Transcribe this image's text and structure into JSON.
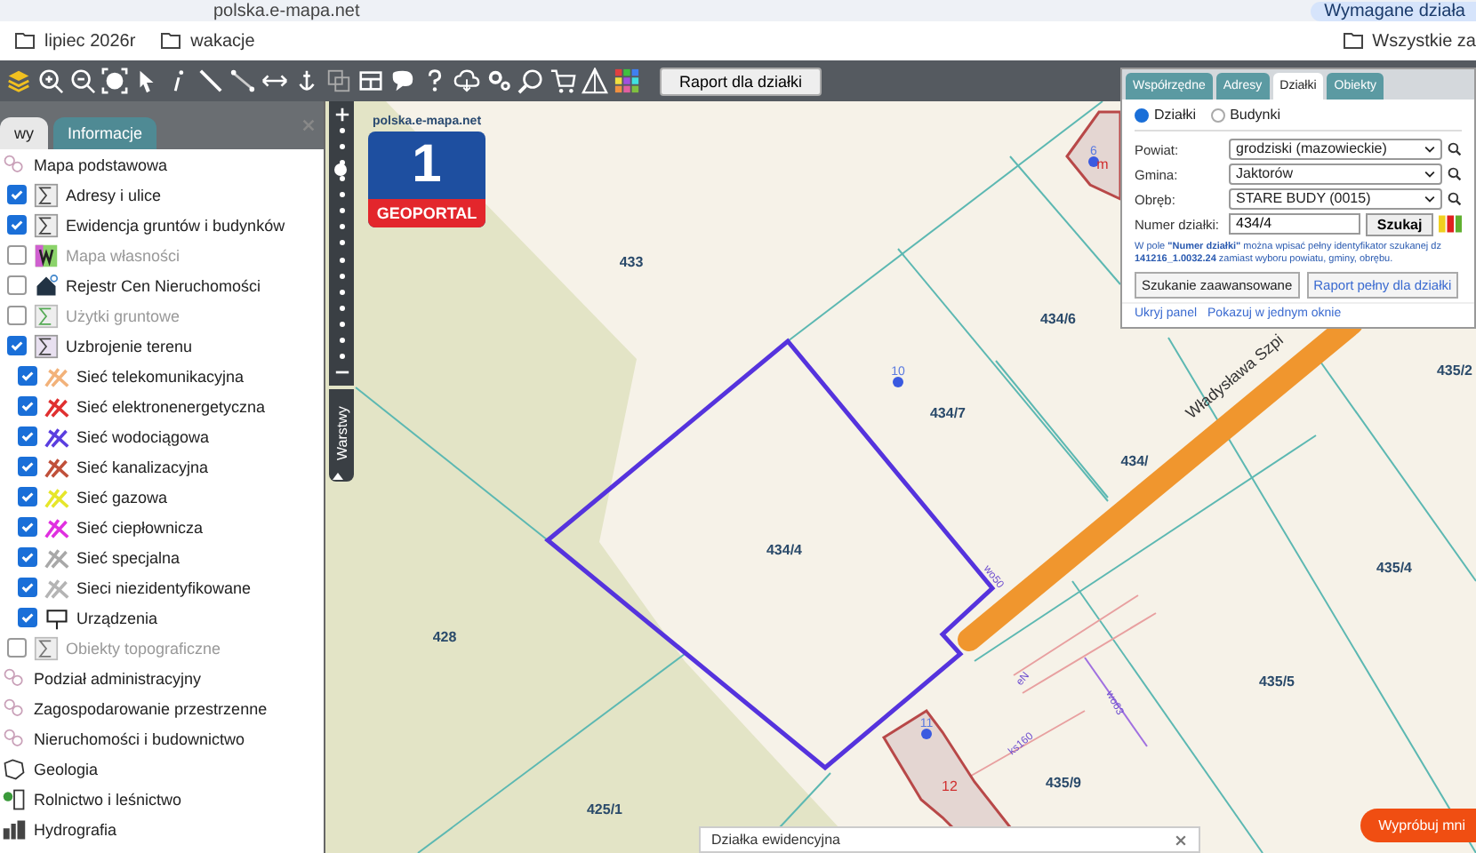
{
  "browser": {
    "address": "polska.e-mapa.net",
    "notice": "Wymagane działa",
    "bookmarks": [
      "lipiec 2026r",
      "wakacje"
    ],
    "all_bookmarks": "Wszystkie za"
  },
  "toolbar": {
    "report_button": "Raport dla działki"
  },
  "sidebar": {
    "tabs": [
      {
        "label": "wy",
        "selected": true
      },
      {
        "label": "Informacje",
        "selected": false
      }
    ],
    "layers": [
      {
        "kind": "category",
        "label": "Mapa podstawowa"
      },
      {
        "kind": "layer",
        "label": "Adresy i ulice",
        "checked": true,
        "disabled": false
      },
      {
        "kind": "layer",
        "label": "Ewidencja gruntów i budynków",
        "checked": true,
        "disabled": false
      },
      {
        "kind": "layer",
        "label": "Mapa własności",
        "checked": false,
        "disabled": true
      },
      {
        "kind": "layer",
        "label": "Rejestr Cen Nieruchomości",
        "checked": false,
        "disabled": false
      },
      {
        "kind": "layer",
        "label": "Użytki gruntowe",
        "checked": false,
        "disabled": true
      },
      {
        "kind": "layer",
        "label": "Uzbrojenie terenu",
        "checked": true,
        "disabled": false,
        "children": [
          {
            "kind": "network",
            "label": "Sieć telekomunikacyjna",
            "checked": true,
            "color": "#f2b27a"
          },
          {
            "kind": "network",
            "label": "Sieć elektronenergetyczna",
            "checked": true,
            "color": "#e03030"
          },
          {
            "kind": "network",
            "label": "Sieć wodociągowa",
            "checked": true,
            "color": "#5a3ee0"
          },
          {
            "kind": "network",
            "label": "Sieć kanalizacyjna",
            "checked": true,
            "color": "#c0503a"
          },
          {
            "kind": "network",
            "label": "Sieć gazowa",
            "checked": true,
            "color": "#e6e62a"
          },
          {
            "kind": "network",
            "label": "Sieć ciepłownicza",
            "checked": true,
            "color": "#e030e0"
          },
          {
            "kind": "network",
            "label": "Sieć specjalna",
            "checked": true,
            "color": "#a8a8a8"
          },
          {
            "kind": "network",
            "label": "Sieci niezidentyfikowane",
            "checked": true,
            "color": "#b4b4b4"
          },
          {
            "kind": "device",
            "label": "Urządzenia",
            "checked": true
          }
        ]
      },
      {
        "kind": "layer",
        "label": "Obiekty topograficzne",
        "checked": false,
        "disabled": true
      },
      {
        "kind": "category",
        "label": "Podział administracyjny"
      },
      {
        "kind": "category",
        "label": "Zagospodarowanie przestrzenne"
      },
      {
        "kind": "category",
        "label": "Nieruchomości i budownictwo"
      },
      {
        "kind": "category",
        "label": "Geologia"
      },
      {
        "kind": "category",
        "label": "Rolnictwo i leśnictwo"
      },
      {
        "kind": "category",
        "label": "Hydrografia"
      }
    ]
  },
  "map": {
    "zoom": {
      "level": 0.82
    },
    "layers_tab": "Warstwy",
    "logo": {
      "site": "polska.e-mapa.net",
      "number": "1",
      "name": "GEOPORTAL"
    },
    "parcel_labels": [
      "433",
      "434/6",
      "434/7",
      "434/4",
      "428",
      "425/1",
      "435/9",
      "435/5",
      "435/4",
      "435/2",
      "434/"
    ],
    "street": "Władysława Szpi",
    "pins": [
      "10",
      "11",
      "6"
    ],
    "building_labels": [
      "12",
      "m"
    ],
    "utility_labels": [
      "wo50",
      "wo63",
      "ks160",
      "eN"
    ],
    "popup": {
      "title": "Działka ewidencyjna"
    },
    "try_button": "Wypróbuj mni"
  },
  "search_panel": {
    "tabs": [
      {
        "label": "Współrzędne",
        "selected": false
      },
      {
        "label": "Adresy",
        "selected": false
      },
      {
        "label": "Działki",
        "selected": true
      },
      {
        "label": "Obiekty",
        "selected": false
      }
    ],
    "modes": [
      {
        "label": "Działki",
        "selected": true
      },
      {
        "label": "Budynki",
        "selected": false
      }
    ],
    "fields": [
      {
        "label": "Powiat:",
        "value": "grodziski (mazowieckie)"
      },
      {
        "label": "Gmina:",
        "value": "Jaktorów"
      },
      {
        "label": "Obręb:",
        "value": "STARE BUDY (0015)"
      }
    ],
    "number_field": {
      "label": "Numer działki:",
      "value": "434/4"
    },
    "search_button": "Szukaj",
    "hint": "W pole **\"Numer działki\"** można wpisać pełny identyfikator szukanej dz **141216_1.0032.24** zamiast wyboru powiatu, gminy, obrębu.",
    "buttons": [
      "Szukanie zaawansowane",
      "Raport pełny dla działki"
    ],
    "links": [
      "Ukryj panel",
      "Pokazuj w jednym oknie"
    ]
  }
}
